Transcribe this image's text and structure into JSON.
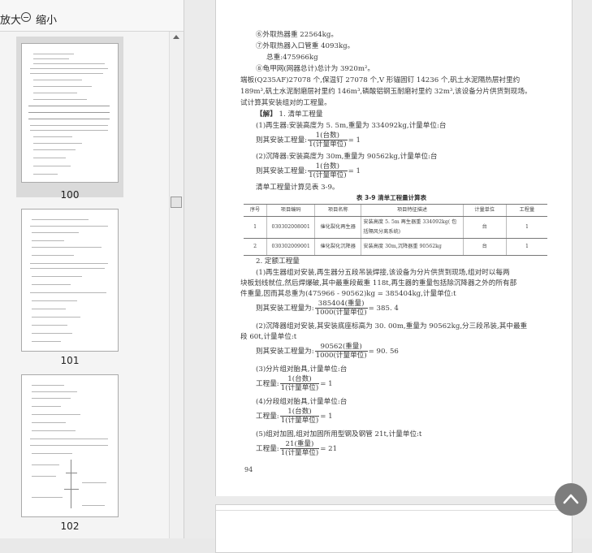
{
  "toolbar": {
    "zoom_in_label": "放大",
    "zoom_out_label": "缩小"
  },
  "thumbnails": [
    {
      "label": "100",
      "selected": true
    },
    {
      "label": "101",
      "selected": false
    },
    {
      "label": "102",
      "selected": false
    }
  ],
  "doc": {
    "lines": [
      "⑥外取热器重 22564kg。",
      "⑦外取热器入口管重 4093kg。",
      "总重:475966kg",
      "⑧龟甲网(网器总计)总计为 3920m²。",
      "端板(Q235AF)27078 个,保温钉 27078 个,V 形锚固钉 14236 个,矾土水泥隔热层衬里约",
      "189m³,矾土水泥耐磨层衬里约 146m³,磷酸铝钢玉耐磨衬里约 32m³,该设备分片供货到现场。",
      "试计算其安装组对的工程量。",
      "(1)再生器:安装高度为 5. 5m,重量为 334092kg,计量单位:台",
      "则其安装工程量:",
      "(2)沉降器:安装高度为 30m,重量为 90562kg,计量单位:台",
      "则其安装工程量:",
      "清单工程量计算见表 3-9。"
    ],
    "answer_label": "【解】",
    "answer_heading": "1. 清单工程量",
    "frac_num_unit": "1(台数)",
    "frac_den_unit": "1(计量单位)",
    "frac_result_1": "= 1",
    "table": {
      "title": "表 3-9   清单工程量计算表",
      "headers": [
        "序号",
        "项目编码",
        "项目名称",
        "项目特征描述",
        "计量单位",
        "工程量"
      ],
      "rows": [
        [
          "1",
          "030302008001",
          "催化裂化再生器",
          "安装高度 5. 5m 再生器重 334092kg( 包括隔风分离系统)",
          "台",
          "1"
        ],
        [
          "2",
          "030302009001",
          "催化裂化沉降器",
          "安装高度 30m,沉降器重 90562kg",
          "台",
          "1"
        ]
      ]
    },
    "section2_heading": "2. 定额工程量",
    "p1_lines": [
      "(1)再生器组对安装,再生器分五段吊装焊接,该设备为分片供货到现场,组对时以每两",
      "块板划线就位,然后焊爆破,其中最重段截重 118t,再生器的重量包括除沉降器之外的所有部",
      "件重量,因而其总重为(475966 - 90562)kg = 385404kg,计量单位:t"
    ],
    "eq1_prefix": "则其安装工程量为:",
    "eq1_num": "385404(重量)",
    "eq1_den": "1000(计量单位)",
    "eq1_result": "= 385. 4",
    "p2_lines": [
      "(2)沉降器组对安装,其安装底座标高为 30. 00m,重量为 90562kg,分三段吊装,其中最重",
      "段 60t,计量单位:t"
    ],
    "eq2_prefix": "则其安装工程量为:",
    "eq2_num": "90562(重量)",
    "eq2_den": "1000(计量单位)",
    "eq2_result": "= 90. 56",
    "p3": "(3)分片组对胎具,计量单位:台",
    "eq_prefix_short": "工程量:",
    "p4": "(4)分段组对胎具,计量单位:台",
    "p5": "(5)组对加固,组对加固所用型钢及钢管 21t,计量单位:t",
    "eq5_num": "21(重量)",
    "eq5_den": "1(计量单位)",
    "eq5_result": "= 21",
    "page_number": "94"
  },
  "icons": {
    "zoom_out": "zoom-out-icon",
    "scroll_top": "chevron-up-icon"
  }
}
